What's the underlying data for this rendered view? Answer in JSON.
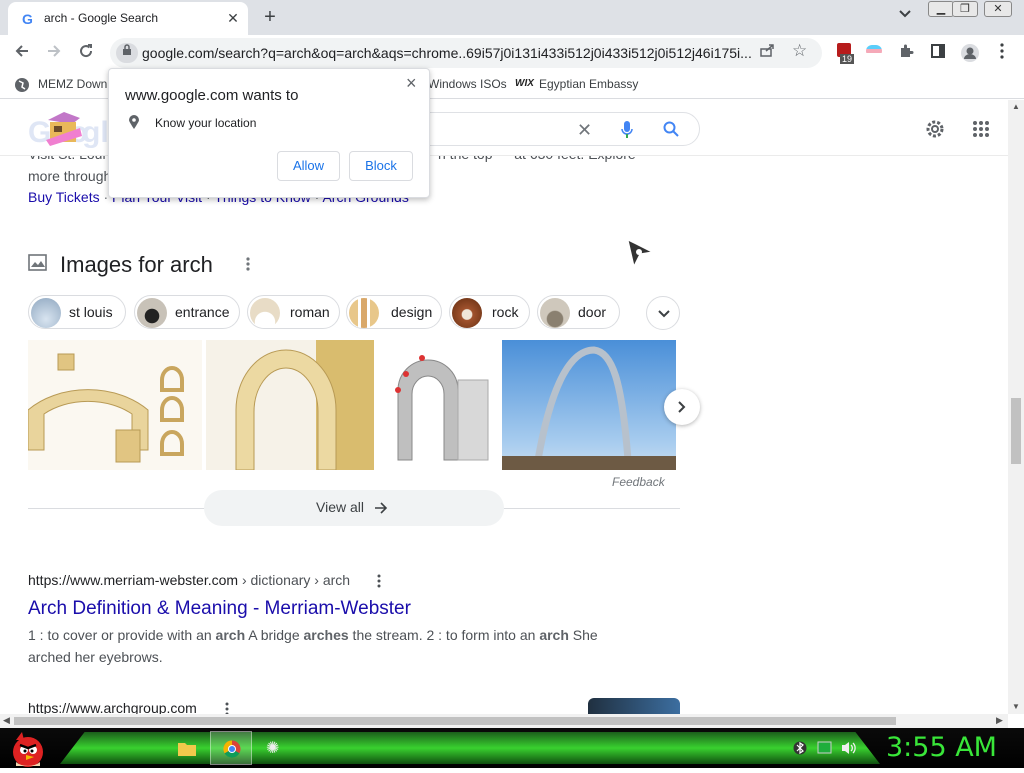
{
  "browser": {
    "tab_title": "arch - Google Search",
    "url": "google.com/search?q=arch&oq=arch&aqs=chrome..69i57j0i131i433i512j0i433i512j0i512j46i175i...",
    "extension_badge": "19"
  },
  "bookmarks": [
    {
      "label": "MEMZ Down"
    },
    {
      "label": "Windows ISOs"
    },
    {
      "label": "Egyptian Embassy"
    }
  ],
  "popup": {
    "title": "www.google.com wants to",
    "permission": "Know your location",
    "allow": "Allow",
    "block": "Block",
    "close": "×"
  },
  "snippet_top": {
    "line1_left": "Visit St. Loui",
    "line1_right": "n the top — at 630 feet. Explore",
    "line2": "more through",
    "links": [
      "Buy Tickets",
      "Plan Your Visit",
      "Things to Know",
      "Arch Grounds"
    ]
  },
  "images_section": {
    "heading": "Images for arch",
    "chips": [
      {
        "label": "st louis"
      },
      {
        "label": "entrance"
      },
      {
        "label": "roman"
      },
      {
        "label": "design"
      },
      {
        "label": "rock"
      },
      {
        "label": "door"
      }
    ],
    "feedback": "Feedback",
    "view_all": "View all"
  },
  "result1": {
    "cite": "https://www.merriam-webster.com",
    "cite_path": " › dictionary › arch",
    "title": "Arch Definition & Meaning - Merriam-Webster",
    "snippet_a": "1 : to cover or provide with an ",
    "snippet_b": "arch",
    "snippet_c": " A bridge ",
    "snippet_d": "arches",
    "snippet_e": " the stream. 2 : to form into an ",
    "snippet_f": "arch",
    "snippet_g": " She",
    "snippet_line2": "arched her eyebrows."
  },
  "result2": {
    "cite": "https://www.archgroup.com"
  },
  "taskbar": {
    "clock": "3:55 AM"
  },
  "colors": {
    "link_blue": "#1a0dab",
    "google_blue": "#4285f4",
    "clock_green": "#39e639"
  }
}
